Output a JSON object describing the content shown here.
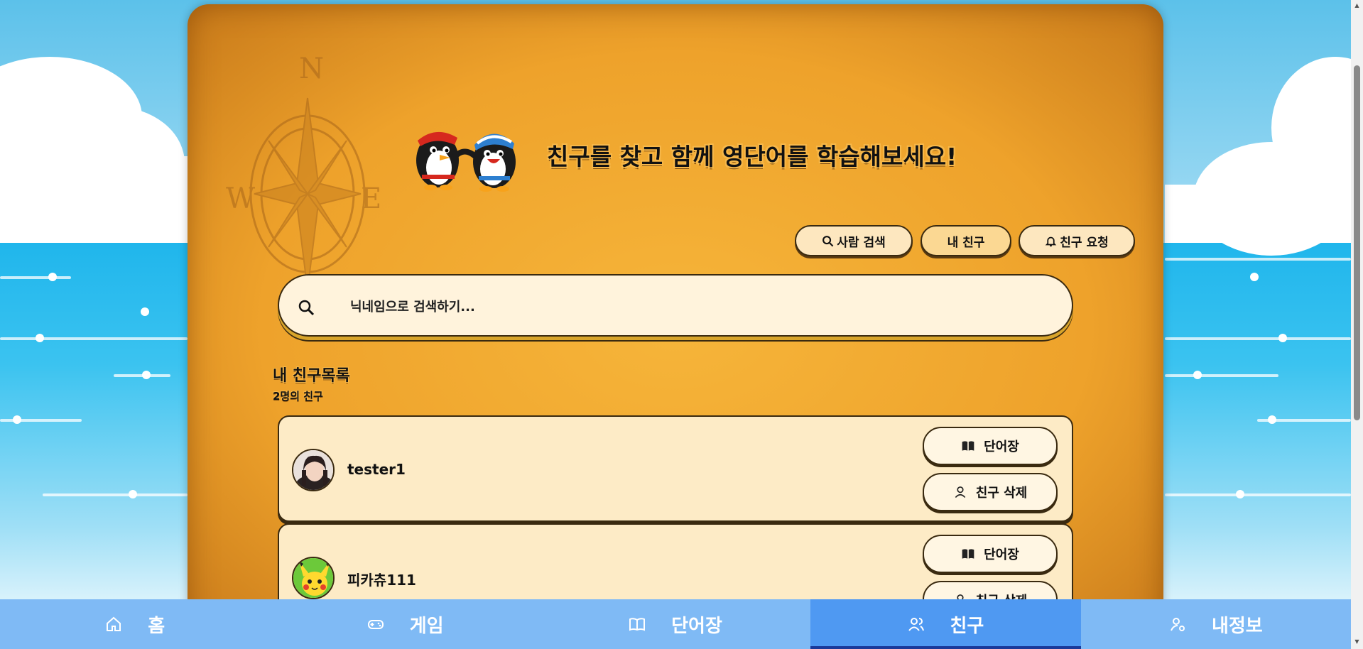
{
  "hero": {
    "title": "친구를 찾고 함께 영단어를 학습해보세요!"
  },
  "compass": {
    "n": "N",
    "w": "W",
    "e": "E"
  },
  "tabs": [
    {
      "label": "사람 검색",
      "icon": "search-icon"
    },
    {
      "label": "내 친구",
      "icon": "none",
      "active": true
    },
    {
      "label": "친구 요청",
      "icon": "bell-icon"
    }
  ],
  "search": {
    "placeholder": "닉네임으로 검색하기..."
  },
  "friends_section": {
    "title": "내 친구목록",
    "count_label": "2명의 친구"
  },
  "friends": [
    {
      "name": "tester1",
      "avatar": "profile-photo",
      "wordbook_label": "단어장",
      "delete_label": "친구 삭제"
    },
    {
      "name": "피카츄111",
      "avatar": "pikachu-avatar",
      "wordbook_label": "단어장",
      "delete_label": "친구 삭제"
    }
  ],
  "nav": [
    {
      "label": "홈",
      "icon": "home-icon"
    },
    {
      "label": "게임",
      "icon": "gamepad-icon"
    },
    {
      "label": "단어장",
      "icon": "book-icon"
    },
    {
      "label": "친구",
      "icon": "users-icon",
      "active": true
    },
    {
      "label": "내정보",
      "icon": "user-settings-icon"
    }
  ],
  "colors": {
    "parchment": "#f0a52d",
    "nav": "#7fbaf5",
    "nav_active": "#4f99f2",
    "card": "#fdebc6"
  }
}
